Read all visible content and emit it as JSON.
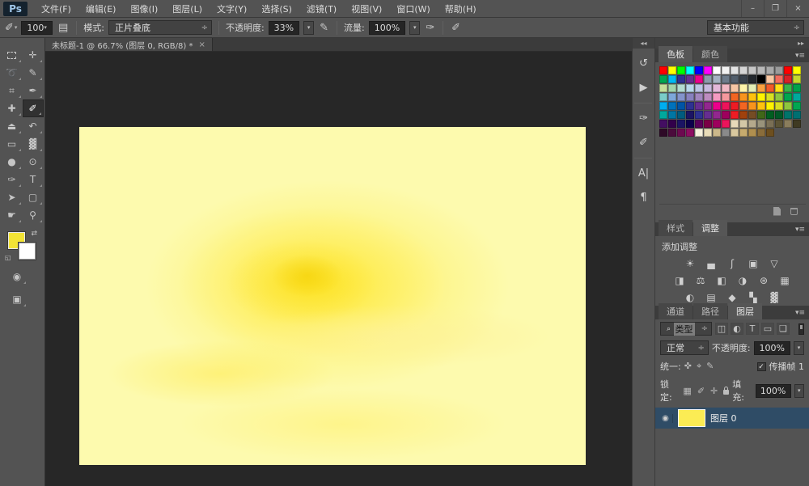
{
  "app": {
    "logo": "Ps"
  },
  "menu": {
    "items": [
      "文件(F)",
      "编辑(E)",
      "图像(I)",
      "图层(L)",
      "文字(Y)",
      "选择(S)",
      "滤镜(T)",
      "视图(V)",
      "窗口(W)",
      "帮助(H)"
    ],
    "window_controls": {
      "minimize": "–",
      "restore": "❐",
      "close": "×"
    }
  },
  "options_bar": {
    "brush_size": "100",
    "mode_label": "模式:",
    "mode_value": "正片叠底",
    "opacity_label": "不透明度:",
    "opacity_value": "33%",
    "flow_label": "流量:",
    "flow_value": "100%",
    "workspace": "基本功能"
  },
  "document_tab": {
    "title": "未标题-1 @ 66.7% (图层 0, RGB/8) *",
    "close": "×"
  },
  "toolbar": {
    "tools": [
      {
        "name": "rectangular-marquee-tool",
        "glyph": "[]"
      },
      {
        "name": "move-tool",
        "glyph": "✛"
      },
      {
        "name": "lasso-tool",
        "glyph": "➰"
      },
      {
        "name": "quick-selection-tool",
        "glyph": "✎"
      },
      {
        "name": "crop-tool",
        "glyph": "⌗"
      },
      {
        "name": "eyedropper-tool",
        "glyph": "✒"
      },
      {
        "name": "spot-healing-brush-tool",
        "glyph": "✚"
      },
      {
        "name": "brush-tool",
        "glyph": "✐",
        "selected": true
      },
      {
        "name": "clone-stamp-tool",
        "glyph": "⏏"
      },
      {
        "name": "history-brush-tool",
        "glyph": "↶"
      },
      {
        "name": "eraser-tool",
        "glyph": "▭"
      },
      {
        "name": "gradient-tool",
        "glyph": "▓"
      },
      {
        "name": "blur-tool",
        "glyph": "●"
      },
      {
        "name": "dodge-tool",
        "glyph": "⊙"
      },
      {
        "name": "pen-tool",
        "glyph": "✑"
      },
      {
        "name": "type-tool",
        "glyph": "T"
      },
      {
        "name": "path-selection-tool",
        "glyph": "➤"
      },
      {
        "name": "rectangle-tool",
        "glyph": "▢"
      },
      {
        "name": "hand-tool",
        "glyph": "☛"
      },
      {
        "name": "zoom-tool",
        "glyph": "⚲"
      }
    ],
    "foreground_color": "#F2E335",
    "background_color": "#FFFFFF",
    "quick_mask_glyph": "◉",
    "screen_mode_glyph": "▣"
  },
  "dock": {
    "expand_glyph": "◂◂",
    "icons": [
      {
        "name": "history-panel-icon",
        "glyph": "↺",
        "group": 1
      },
      {
        "name": "actions-panel-icon",
        "glyph": "▶",
        "group": 1
      },
      {
        "name": "properties-panel-icon",
        "glyph": "✑",
        "group": 2
      },
      {
        "name": "brush-panel-icon",
        "glyph": "✐",
        "group": 2
      },
      {
        "name": "character-panel-icon",
        "glyph": "A|",
        "group": 3
      },
      {
        "name": "paragraph-panel-icon",
        "glyph": "¶",
        "group": 3
      }
    ]
  },
  "panels_header": {
    "collapse_glyph": "▸▸"
  },
  "swatches_panel": {
    "tabs": [
      {
        "label": "颜色",
        "active": false
      },
      {
        "label": "色板",
        "active": true
      }
    ],
    "rows": [
      [
        "#ff0000",
        "#ffff00",
        "#00ff00",
        "#00ffff",
        "#0000ff",
        "#ff00ff",
        "#ffffff",
        "#f2f2f2",
        "#e3e3e3",
        "#d5d5d5",
        "#c6c6c6",
        "#b8b8b8",
        "#a9a9a9",
        "#9b9b9b",
        "#ff0000",
        "#ffff00"
      ],
      [
        "#00a651",
        "#00b9f2",
        "#2e3192",
        "#662d91",
        "#ec008c",
        "#8c9bac",
        "#a5b2c1",
        "#6d7b8a",
        "#525e6b",
        "#39424c",
        "#23282e",
        "#000000",
        "#f7c7a3",
        "#f26d5e",
        "#d92027",
        "#c5d92d"
      ],
      [
        "#c4df9b",
        "#a2d5ac",
        "#b3dbd0",
        "#b8d8eb",
        "#bcc5e4",
        "#c7b9dd",
        "#e3b8d9",
        "#f1b8c4",
        "#f6c6a4",
        "#fdf3a9",
        "#e2edb5",
        "#f9a03f",
        "#f15a29",
        "#ffde17",
        "#39b54a",
        "#00a14b"
      ],
      [
        "#7accc8",
        "#7da7d9",
        "#8393ca",
        "#8781bd",
        "#a186be",
        "#bd8cbf",
        "#f49ac1",
        "#f5989d",
        "#f26522",
        "#f7941d",
        "#ffc20e",
        "#fff200",
        "#d7df23",
        "#8dc63f",
        "#00a651",
        "#00a99d"
      ],
      [
        "#00aeef",
        "#0072bc",
        "#0054a6",
        "#2e3192",
        "#662d91",
        "#92278f",
        "#ec008c",
        "#ed145b",
        "#ed1c24",
        "#f26522",
        "#f7941d",
        "#ffc20e",
        "#fff200",
        "#d7df23",
        "#8dc63f",
        "#00a651"
      ],
      [
        "#00a99d",
        "#0076a3",
        "#005b7f",
        "#1b1464",
        "#2e3192",
        "#662d91",
        "#92278f",
        "#9e005d",
        "#ed1c24",
        "#a0410d",
        "#754c24",
        "#406618",
        "#005e20",
        "#005826",
        "#00746b",
        "#006f71"
      ],
      [
        "#440e62",
        "#32004b",
        "#1b1464",
        "#0d004c",
        "#590059",
        "#7b0046",
        "#9e005d",
        "#ed145b",
        "#e7d9b9",
        "#d3c7a6",
        "#b5a98c",
        "#99937b",
        "#7a6f55",
        "#5c5436",
        "#8a7d5c",
        "#3f3a22"
      ],
      [
        "#2e0927",
        "#4b0a3c",
        "#6d0a50",
        "#8e0e62",
        "#f5f0dc",
        "#e8dcb8",
        "#cbb88a",
        "#8a8a8a",
        "#d9c89e",
        "#c7ab6e",
        "#b08f4f",
        "#8a6d3b",
        "#6d4f1f"
      ]
    ]
  },
  "adjustments_panel": {
    "tabs": [
      {
        "label": "调整",
        "active": true
      },
      {
        "label": "样式",
        "active": false
      }
    ],
    "add_label": "添加调整",
    "icon_rows": [
      [
        {
          "name": "brightness-contrast-icon",
          "glyph": "☀"
        },
        {
          "name": "levels-icon",
          "glyph": "▄"
        },
        {
          "name": "curves-icon",
          "glyph": "ʃ"
        },
        {
          "name": "exposure-icon",
          "glyph": "▣"
        },
        {
          "name": "vibrance-icon",
          "glyph": "▽"
        }
      ],
      [
        {
          "name": "hue-saturation-icon",
          "glyph": "◨"
        },
        {
          "name": "color-balance-icon",
          "glyph": "⚖"
        },
        {
          "name": "black-white-icon",
          "glyph": "◧"
        },
        {
          "name": "photo-filter-icon",
          "glyph": "◑"
        },
        {
          "name": "channel-mixer-icon",
          "glyph": "⊛"
        },
        {
          "name": "color-lookup-icon",
          "glyph": "▦"
        }
      ],
      [
        {
          "name": "invert-icon",
          "glyph": "◐"
        },
        {
          "name": "posterize-icon",
          "glyph": "▤"
        },
        {
          "name": "threshold-icon",
          "glyph": "◆"
        },
        {
          "name": "selective-color-icon",
          "glyph": "▚"
        },
        {
          "name": "gradient-map-icon",
          "glyph": "▓"
        }
      ]
    ]
  },
  "layers_panel": {
    "tabs": [
      {
        "label": "图层",
        "active": true
      },
      {
        "label": "通道",
        "active": false
      },
      {
        "label": "路径",
        "active": false
      }
    ],
    "filter_label": "类型",
    "filter_icons": [
      {
        "name": "filter-pixel-layers-icon",
        "glyph": "◫"
      },
      {
        "name": "filter-adjustment-layers-icon",
        "glyph": "◐"
      },
      {
        "name": "filter-type-layers-icon",
        "glyph": "T"
      },
      {
        "name": "filter-shape-layers-icon",
        "glyph": "▭"
      },
      {
        "name": "filter-smart-objects-icon",
        "glyph": "❏"
      }
    ],
    "blend_mode": "正常",
    "opacity_label": "不透明度:",
    "opacity_value": "100%",
    "unify_label": "统一:",
    "unify_icons": [
      {
        "name": "unify-position-icon",
        "glyph": "✜"
      },
      {
        "name": "unify-visibility-icon",
        "glyph": "⌖"
      },
      {
        "name": "unify-style-icon",
        "glyph": "✎"
      }
    ],
    "propagate_checked": "✓",
    "propagate_label": "传播帧 1",
    "lock_label": "锁定:",
    "lock_icons": [
      {
        "name": "lock-transparency-icon",
        "glyph": "▦"
      },
      {
        "name": "lock-pixels-icon",
        "glyph": "✐"
      },
      {
        "name": "lock-position-icon",
        "glyph": "✛"
      },
      {
        "name": "lock-all-icon",
        "glyph": "padlock"
      }
    ],
    "fill_label": "填充:",
    "fill_value": "100%",
    "layer": {
      "name": "图层 0",
      "eye_glyph": "◉",
      "thumb_color": "#FBEC54"
    }
  }
}
